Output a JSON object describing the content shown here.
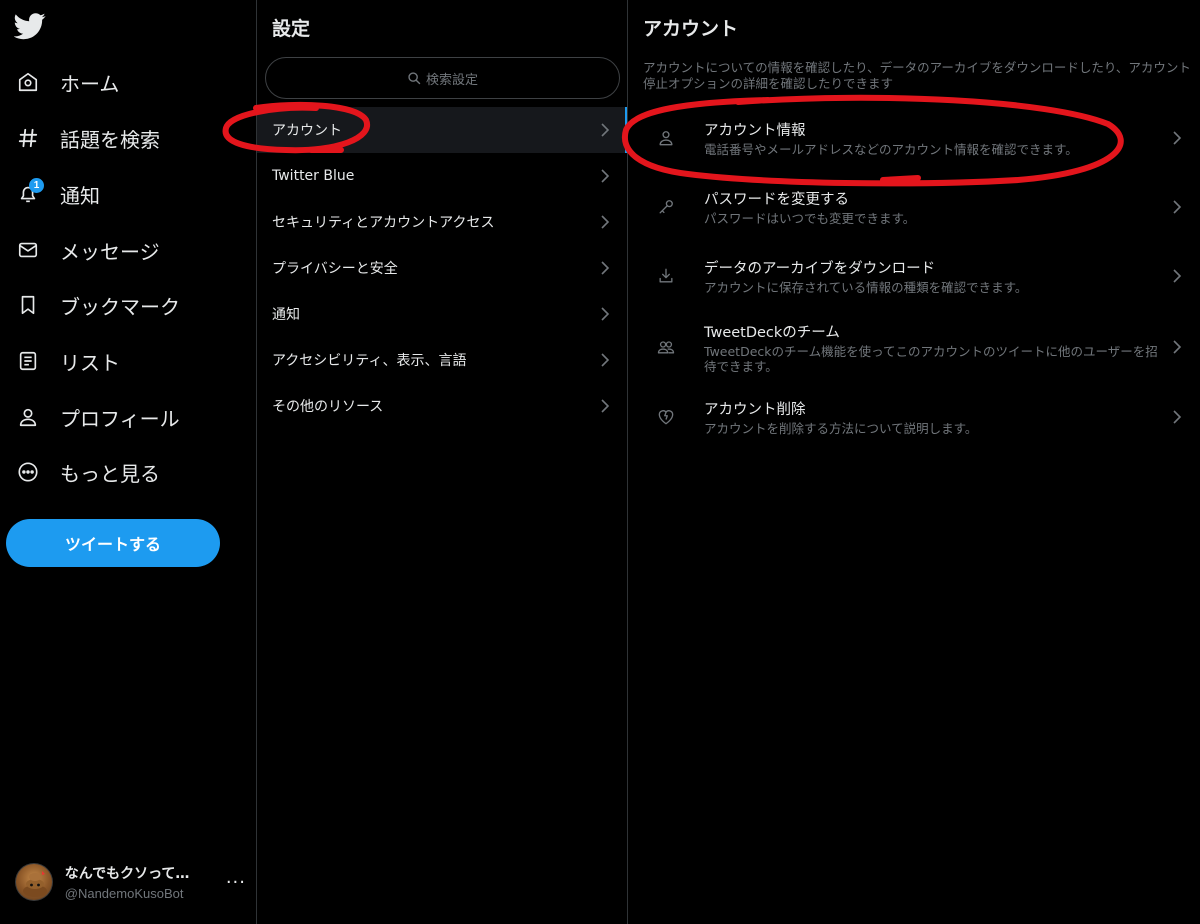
{
  "nav": {
    "items": [
      {
        "label": "ホーム",
        "icon": "home-icon"
      },
      {
        "label": "話題を検索",
        "icon": "hashtag-icon"
      },
      {
        "label": "通知",
        "icon": "bell-icon",
        "badge": "1"
      },
      {
        "label": "メッセージ",
        "icon": "mail-icon"
      },
      {
        "label": "ブックマーク",
        "icon": "bookmark-icon"
      },
      {
        "label": "リスト",
        "icon": "list-icon"
      },
      {
        "label": "プロフィール",
        "icon": "person-icon"
      },
      {
        "label": "もっと見る",
        "icon": "more-circle-icon"
      }
    ],
    "tweet_button": "ツイートする",
    "account": {
      "name": "なんでもクソって…",
      "handle": "@NandemoKusoBot",
      "more": "···"
    }
  },
  "settings": {
    "title": "設定",
    "search_placeholder": "検索設定",
    "items": [
      {
        "label": "アカウント",
        "active": true
      },
      {
        "label": "Twitter Blue"
      },
      {
        "label": "セキュリティとアカウントアクセス"
      },
      {
        "label": "プライバシーと安全"
      },
      {
        "label": "通知"
      },
      {
        "label": "アクセシビリティ、表示、言語"
      },
      {
        "label": "その他のリソース"
      }
    ]
  },
  "account": {
    "title": "アカウント",
    "description": "アカウントについての情報を確認したり、データのアーカイブをダウンロードしたり、アカウント停止オプションの詳細を確認したりできます",
    "options": [
      {
        "title": "アカウント情報",
        "subtitle": "電話番号やメールアドレスなどのアカウント情報を確認できます。",
        "icon": "person-icon"
      },
      {
        "title": "パスワードを変更する",
        "subtitle": "パスワードはいつでも変更できます。",
        "icon": "key-icon"
      },
      {
        "title": "データのアーカイブをダウンロード",
        "subtitle": "アカウントに保存されている情報の種類を確認できます。",
        "icon": "download-icon"
      },
      {
        "title": "TweetDeckのチーム",
        "subtitle": "TweetDeckのチーム機能を使ってこのアカウントのツイートに他のユーザーを招待できます。",
        "icon": "team-icon"
      },
      {
        "title": "アカウント削除",
        "subtitle": "アカウントを削除する方法について説明します。",
        "icon": "broken-heart-icon"
      }
    ]
  },
  "colors": {
    "accent": "#1d9bf0",
    "annotation": "#e3151c",
    "text_secondary": "#71767b",
    "border": "#2f3336"
  }
}
